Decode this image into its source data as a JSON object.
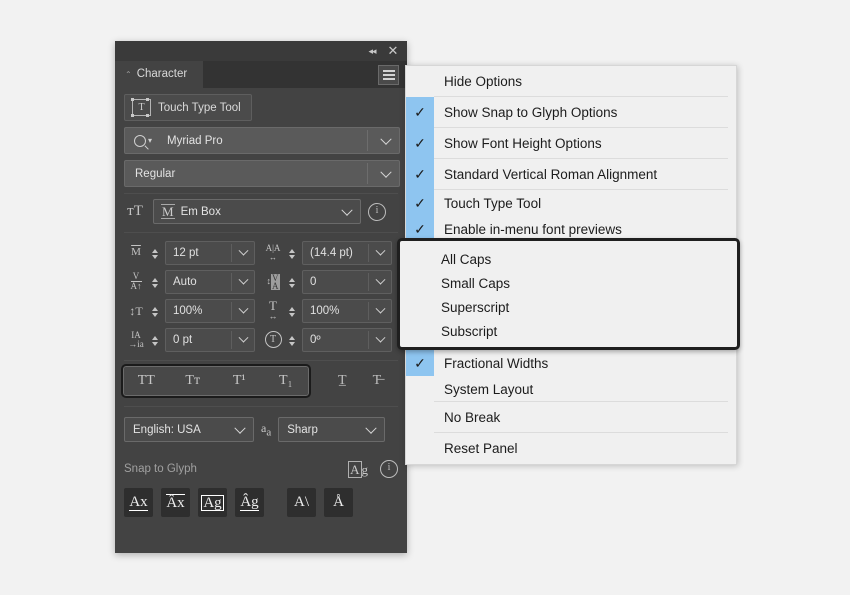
{
  "panel": {
    "titlebar": {
      "collapse_icon": "collapse-icon",
      "close_label": "✕",
      "collapse_label": "◂◂"
    },
    "tab": {
      "label": "Character",
      "caret": "⌃"
    },
    "touch_type_tool": {
      "label": "Touch Type Tool"
    },
    "font_family": {
      "value": "Myriad Pro"
    },
    "font_style": {
      "value": "Regular"
    },
    "font_height": {
      "value": "Em Box"
    },
    "fields": [
      {
        "icon": "M",
        "value": "12 pt"
      },
      {
        "icon": "A|A",
        "value": "(14.4 pt)"
      },
      {
        "icon": "A/V",
        "value": "Auto"
      },
      {
        "icon": "VA",
        "value": "0"
      },
      {
        "icon": "T-vertical",
        "value": "100%"
      },
      {
        "icon": "T-horizontal",
        "value": "100%"
      },
      {
        "icon": "baseline",
        "value": "0 pt"
      },
      {
        "icon": "rotate",
        "value": "0º"
      }
    ],
    "style_buttons": [
      {
        "name": "all-caps-button",
        "label": "TT"
      },
      {
        "name": "small-caps-button",
        "label": "Tᴛ"
      },
      {
        "name": "superscript-button",
        "label": "T¹"
      },
      {
        "name": "subscript-button",
        "label": "T₁"
      }
    ],
    "style_extra": [
      {
        "name": "underline-button",
        "label": "T̲"
      },
      {
        "name": "strikethrough-button",
        "label": "T̶"
      }
    ],
    "language": {
      "value": "English: USA"
    },
    "anti_alias": {
      "value": "Sharp",
      "icon": "aa-icon"
    },
    "snap_to_glyph": {
      "label": "Snap to Glyph",
      "preview_icon": "Ag",
      "buttons": [
        {
          "name": "snap-x-height-button",
          "label": "Ax"
        },
        {
          "name": "snap-cap-height-button",
          "label": "Ax"
        },
        {
          "name": "snap-em-box-button",
          "label": "Ag"
        },
        {
          "name": "snap-baseline-button",
          "label": "Ag"
        },
        {
          "name": "snap-angle-button",
          "label": "A\\"
        },
        {
          "name": "snap-italic-button",
          "label": "A"
        }
      ]
    }
  },
  "menu": {
    "items": [
      {
        "label": "Hide Options",
        "checked": false,
        "separator": true
      },
      {
        "label": "Show Snap to Glyph Options",
        "checked": true,
        "separator": true
      },
      {
        "label": "Show Font Height Options",
        "checked": true,
        "separator": true
      },
      {
        "label": "Standard Vertical Roman Alignment",
        "checked": true,
        "separator": true
      },
      {
        "label": "Touch Type Tool",
        "checked": true,
        "separator": false
      },
      {
        "label": "Enable in-menu font previews",
        "checked": true,
        "separator": false
      }
    ],
    "items_after": [
      {
        "label": "Fractional Widths",
        "checked": true,
        "separator": false
      },
      {
        "label": "System Layout",
        "checked": false,
        "separator": true
      },
      {
        "label": "No Break",
        "checked": false,
        "separator": true
      },
      {
        "label": "Reset Panel",
        "checked": false,
        "separator": false
      }
    ],
    "highlighted_group": [
      {
        "label": "All Caps"
      },
      {
        "label": "Small Caps"
      },
      {
        "label": "Superscript"
      },
      {
        "label": "Subscript"
      }
    ],
    "check_glyph": "✓"
  },
  "colors": {
    "panel_bg": "#434343",
    "menu_bg": "#f0f0f0",
    "check_highlight": "#8ec5f0",
    "highlight_border": "#1f1f1f",
    "page_bg": "#f2f2f2"
  }
}
